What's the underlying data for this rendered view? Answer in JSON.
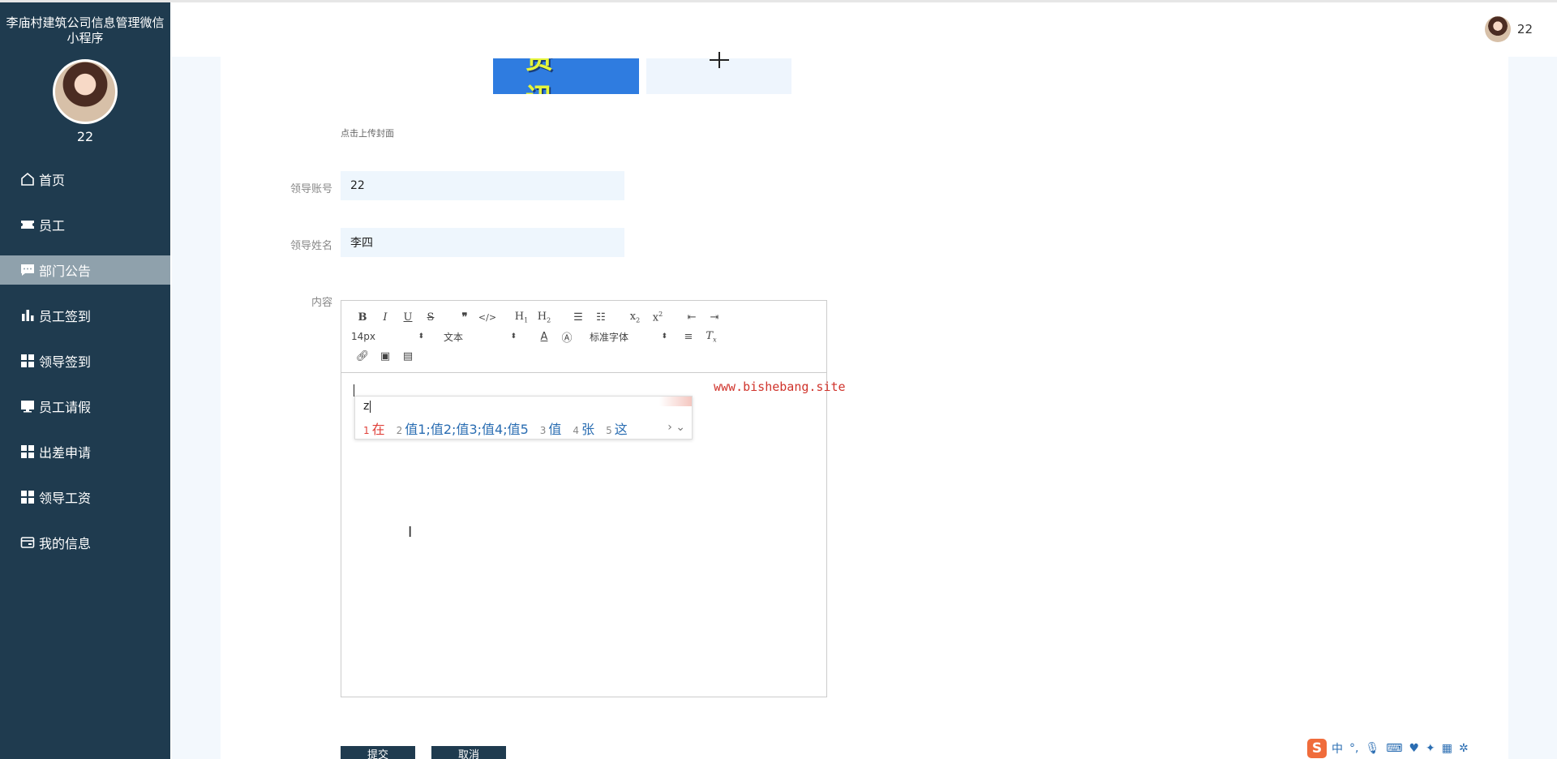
{
  "app": {
    "title": "李庙村建筑公司信息管理微信小程序",
    "user_name": "22"
  },
  "header": {
    "user_name": "22"
  },
  "sidebar": {
    "items": [
      {
        "label": "首页",
        "icon": "home-icon"
      },
      {
        "label": "员工",
        "icon": "ticket-icon"
      },
      {
        "label": "部门公告",
        "icon": "chat-icon",
        "active": true
      },
      {
        "label": "员工签到",
        "icon": "bar-chart-icon"
      },
      {
        "label": "领导签到",
        "icon": "grid-icon"
      },
      {
        "label": "员工请假",
        "icon": "monitor-icon"
      },
      {
        "label": "出差申请",
        "icon": "grid-icon"
      },
      {
        "label": "领导工资",
        "icon": "grid-icon"
      },
      {
        "label": "我的信息",
        "icon": "card-icon"
      }
    ]
  },
  "cover": {
    "banner_text": "资讯",
    "hint": "点击上传封面"
  },
  "form": {
    "account_label": "领导账号",
    "account_value": "22",
    "name_label": "领导姓名",
    "name_value": "李四",
    "content_label": "内容"
  },
  "editor": {
    "font_size": "14px",
    "heading": "文本",
    "font_family": "标准字体"
  },
  "ime": {
    "input": "z",
    "candidates": [
      {
        "num": "1",
        "text": "在"
      },
      {
        "num": "2",
        "text": "值1;值2;值3;值4;值5"
      },
      {
        "num": "3",
        "text": "值"
      },
      {
        "num": "4",
        "text": "张"
      },
      {
        "num": "5",
        "text": "这"
      }
    ]
  },
  "watermark": "www.bishebang.site",
  "buttons": {
    "submit": "提交",
    "cancel": "取消"
  },
  "tray": {
    "mode": "中"
  },
  "colors": {
    "sidebar_bg": "#1f3b4f",
    "active_item": "#8fa1ac",
    "panel": "#f3f8fd"
  }
}
